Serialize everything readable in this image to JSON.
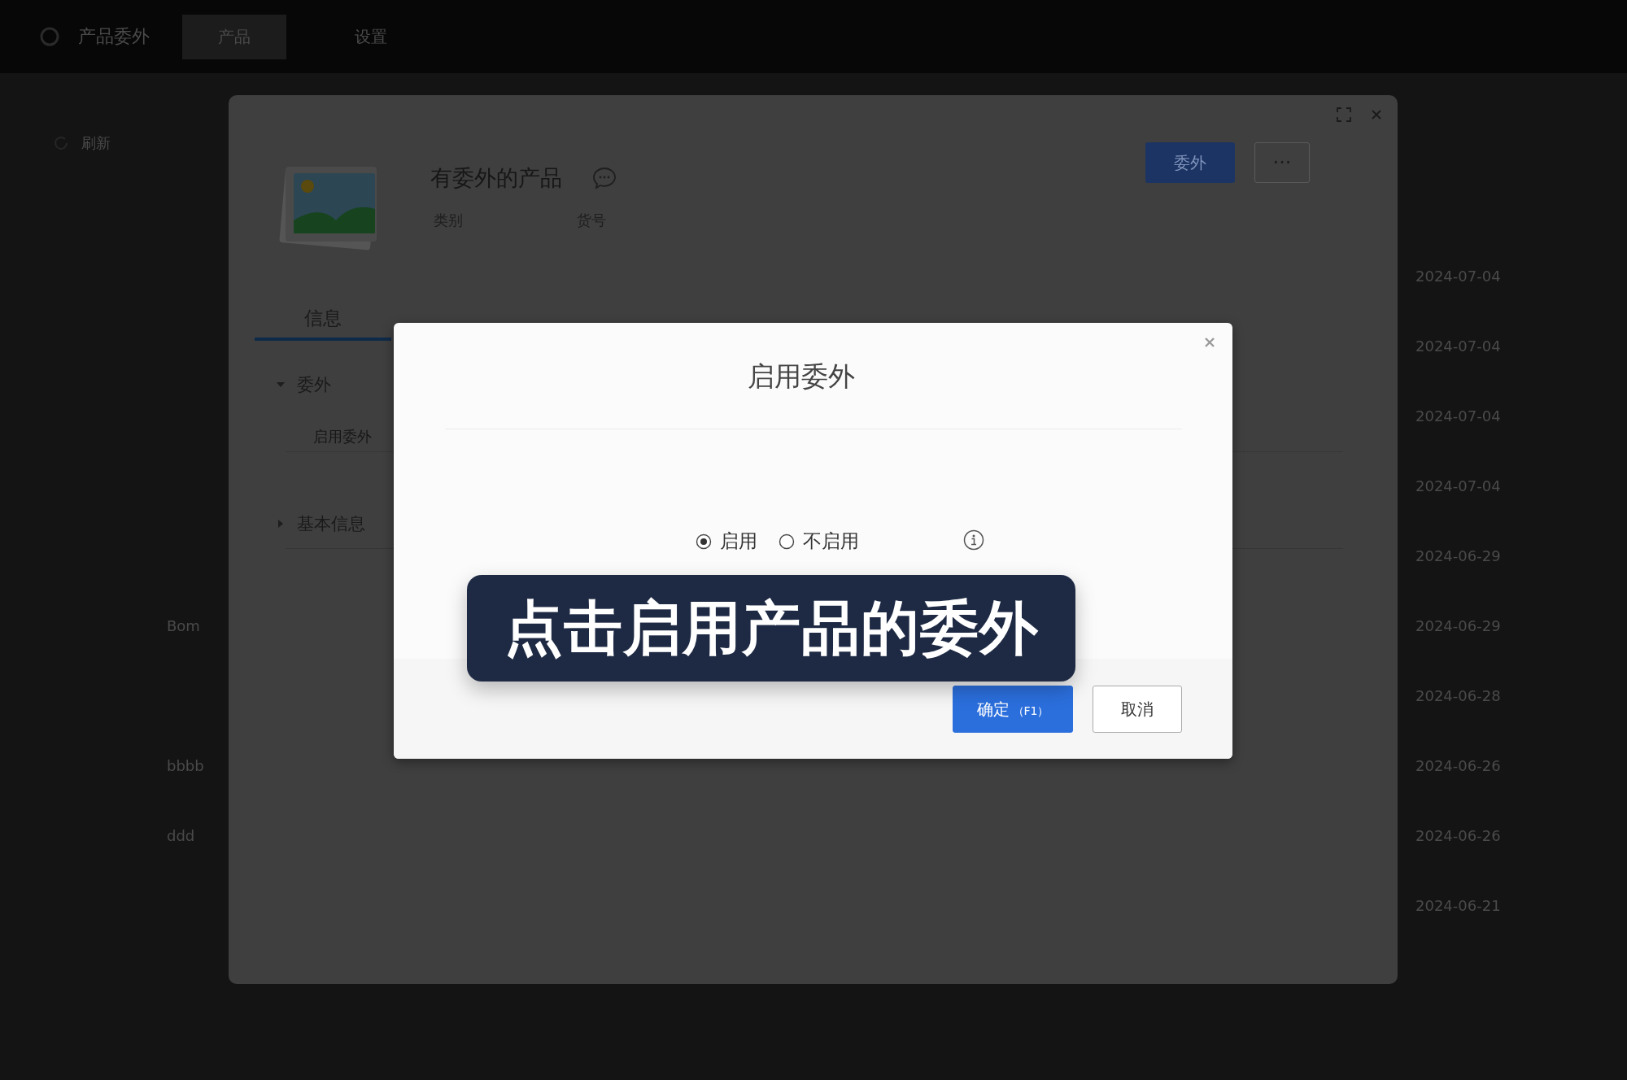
{
  "top_bar": {
    "app_title": "产品委外",
    "nav": [
      {
        "label": "产品",
        "selected": true
      },
      {
        "label": "设置",
        "selected": false
      }
    ]
  },
  "toolbar": {
    "refresh": "刷新"
  },
  "product_rows": [
    {
      "date": "2024-07-04"
    },
    {
      "date": "2024-07-04"
    },
    {
      "date": "2024-07-04"
    },
    {
      "date": "2024-07-04"
    },
    {
      "date": "2024-06-29"
    },
    {
      "name": "Bom",
      "date": "2024-06-29"
    },
    {
      "date": "2024-06-28"
    },
    {
      "name": "bbbb",
      "date": "2024-06-26"
    },
    {
      "name": "ddd",
      "date": "2024-06-26"
    },
    {
      "date": "2024-06-21"
    }
  ],
  "product_dialog": {
    "title": "有委外的产品",
    "fields": [
      "类别",
      "货号"
    ],
    "primary_action": "委外",
    "more": "···",
    "tabs": [
      {
        "label": "信息",
        "selected": true
      }
    ],
    "sections": [
      {
        "title": "委外",
        "expanded": true,
        "items": [
          "启用委外"
        ]
      },
      {
        "title": "基本信息",
        "expanded": false
      }
    ]
  },
  "enable_dialog": {
    "title": "启用委外",
    "options": [
      {
        "label": "启用",
        "selected": true
      },
      {
        "label": "不启用",
        "selected": false
      }
    ],
    "buttons": [
      {
        "label": "确定",
        "shortcut": "（F1）",
        "kind": "primary"
      },
      {
        "label": "取消",
        "kind": "secondary"
      }
    ]
  },
  "tooltip": {
    "text": "点击启用产品的委外"
  }
}
